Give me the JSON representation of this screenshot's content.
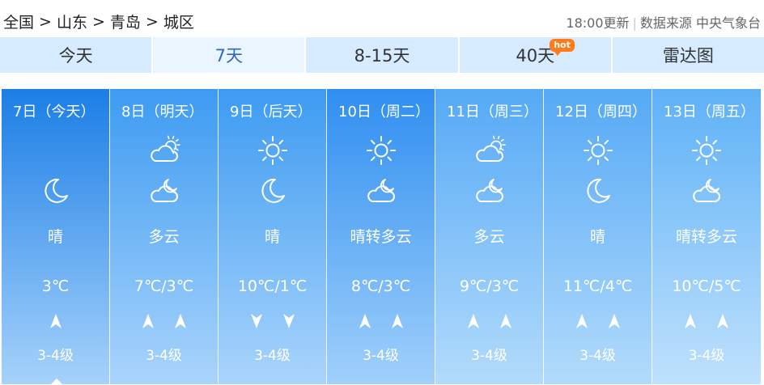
{
  "breadcrumb": [
    "全国",
    "山东",
    "青岛",
    "城区"
  ],
  "breadcrumb_sep": ">",
  "update_time": "18:00更新",
  "data_source": "数据来源 中央气象台",
  "tabs": [
    {
      "label": "今天"
    },
    {
      "label": "7天"
    },
    {
      "label": "8-15天"
    },
    {
      "label": "40天",
      "badge": "hot"
    },
    {
      "label": "雷达图"
    }
  ],
  "days": [
    {
      "date": "7日（今天）",
      "day_icon": "",
      "night_icon": "moon-icon",
      "weather": "晴",
      "temp": "3℃",
      "wind_dirs": [
        "north-arrow-icon"
      ],
      "wind_level": "3-4级"
    },
    {
      "date": "8日（明天）",
      "day_icon": "partly-cloudy-icon",
      "night_icon": "cloudy-night-icon",
      "weather": "多云",
      "temp": "7℃/3℃",
      "wind_dirs": [
        "north-arrow-icon",
        "north-arrow-icon"
      ],
      "wind_level": "3-4级"
    },
    {
      "date": "9日（后天）",
      "day_icon": "sun-icon",
      "night_icon": "moon-icon",
      "weather": "晴",
      "temp": "10℃/1℃",
      "wind_dirs": [
        "south-arrow-icon",
        "south-arrow-icon"
      ],
      "wind_level": "3-4级"
    },
    {
      "date": "10日（周二）",
      "day_icon": "sun-icon",
      "night_icon": "cloudy-night-icon",
      "weather": "晴转多云",
      "temp": "8℃/3℃",
      "wind_dirs": [
        "north-arrow-icon",
        "north-arrow-icon"
      ],
      "wind_level": "3-4级"
    },
    {
      "date": "11日（周三）",
      "day_icon": "partly-cloudy-icon",
      "night_icon": "cloudy-night-icon",
      "weather": "多云",
      "temp": "9℃/3℃",
      "wind_dirs": [
        "north-arrow-icon",
        "north-arrow-icon"
      ],
      "wind_level": "3-4级"
    },
    {
      "date": "12日（周四）",
      "day_icon": "sun-icon",
      "night_icon": "moon-icon",
      "weather": "晴",
      "temp": "11℃/4℃",
      "wind_dirs": [
        "north-arrow-icon",
        "north-arrow-icon"
      ],
      "wind_level": "3-4级"
    },
    {
      "date": "13日（周五）",
      "day_icon": "sun-icon",
      "night_icon": "cloudy-night-icon",
      "weather": "晴转多云",
      "temp": "10℃/5℃",
      "wind_dirs": [
        "north-arrow-icon",
        "north-arrow-icon"
      ],
      "wind_level": "3-4级"
    }
  ],
  "colors": {
    "accent": "#2f66c2",
    "tab_bg": "#d6ebff",
    "hot_badge": "#ff7a1a"
  }
}
